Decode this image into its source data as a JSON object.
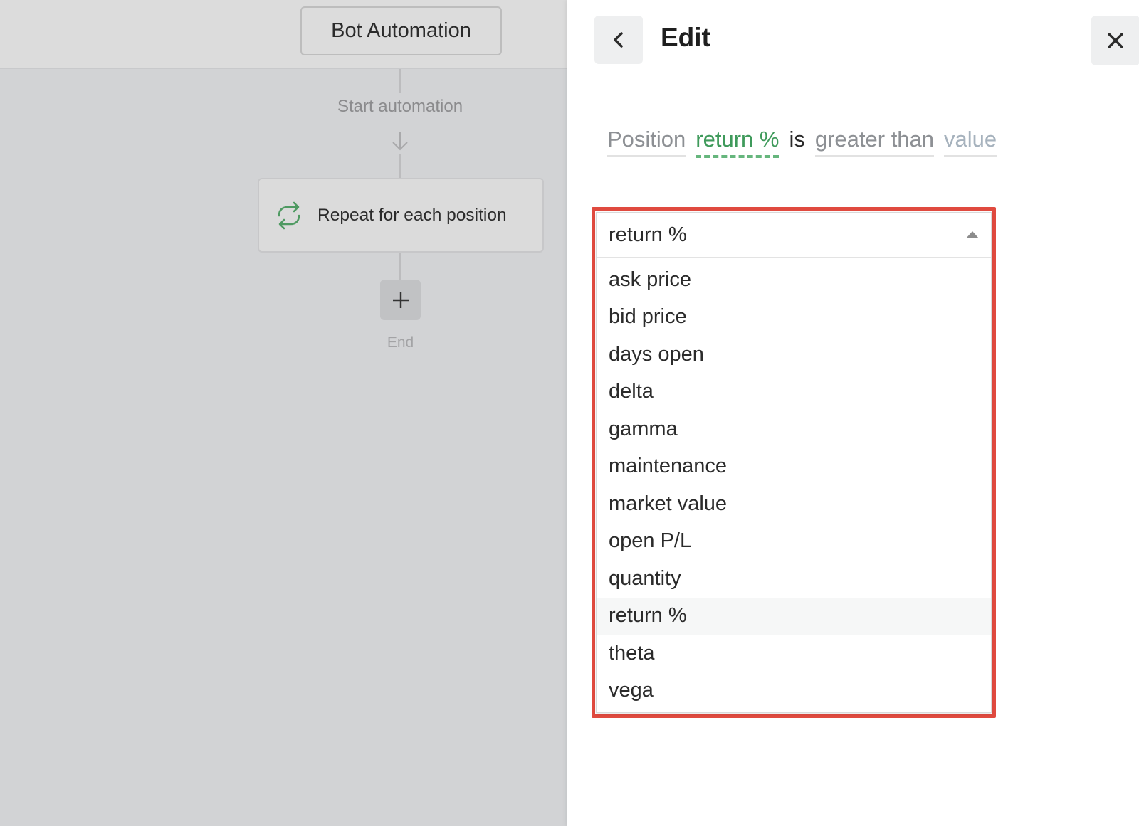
{
  "canvas": {
    "title": "Bot Automation",
    "start_label": "Start automation",
    "repeat_label": "Repeat for each position",
    "end_label": "End"
  },
  "panel": {
    "title": "Edit",
    "condition": {
      "subject": "Position",
      "field": "return %",
      "verb": "is",
      "operator": "greater than",
      "value_placeholder": "value"
    },
    "dropdown": {
      "selected": "return %",
      "options": [
        "ask price",
        "bid price",
        "days open",
        "delta",
        "gamma",
        "maintenance",
        "market value",
        "open P/L",
        "quantity",
        "return %",
        "theta",
        "vega"
      ]
    }
  },
  "colors": {
    "accent_green": "#3f9a5b",
    "highlight_red": "#e04a3f"
  }
}
